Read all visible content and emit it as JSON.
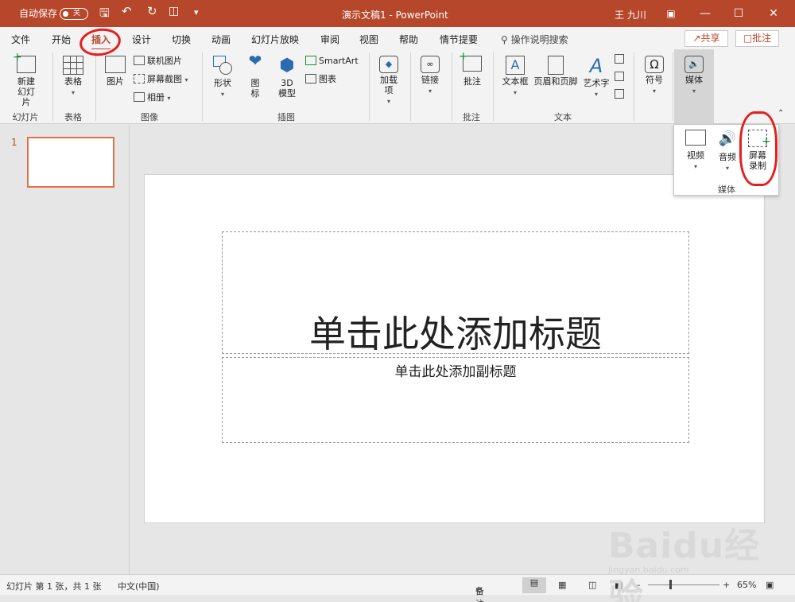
{
  "titlebar": {
    "autosave_label": "自动保存",
    "autosave_state": "关",
    "doc_title": "演示文稿1 - PowerPoint",
    "user": "王 九川"
  },
  "tabs": {
    "items": [
      "文件",
      "开始",
      "插入",
      "设计",
      "切换",
      "动画",
      "幻灯片放映",
      "审阅",
      "视图",
      "帮助",
      "情节提要"
    ],
    "active": "插入",
    "search": "操作说明搜索",
    "share": "共享",
    "comment": "批注"
  },
  "ribbon": {
    "slides_group": {
      "label": "幻灯片",
      "new_slide": "新建幻灯片"
    },
    "table_group": {
      "label": "表格",
      "table": "表格"
    },
    "image_group": {
      "label": "图像",
      "picture": "图片",
      "online": "联机图片",
      "screenshot": "屏幕截图",
      "album": "相册"
    },
    "illus_group": {
      "label": "插图",
      "shapes": "形状",
      "icons": "图标",
      "model3d": "3D 模型",
      "smartart": "SmartArt",
      "chart": "图表"
    },
    "addins": "加载项",
    "links": "链接",
    "comments_group": {
      "label": "批注",
      "comment": "批注"
    },
    "text_group": {
      "label": "文本",
      "textbox": "文本框",
      "header_footer": "页眉和页脚",
      "wordart": "艺术字"
    },
    "symbols": "符号",
    "media": "媒体"
  },
  "media_dropdown": {
    "video": "视频",
    "audio": "音频",
    "screen_rec": "屏幕录制",
    "label": "媒体"
  },
  "slide_panel": {
    "num": "1"
  },
  "slide": {
    "title_placeholder": "单击此处添加标题",
    "subtitle_placeholder": "单击此处添加副标题"
  },
  "status": {
    "slide_info": "幻灯片 第 1 张，共 1 张",
    "lang": "中文(中国)",
    "notes": "备注",
    "zoom": "65%"
  },
  "watermark": {
    "text": "Baidu经验",
    "sub": "jingyan.baidu.com"
  },
  "colors": {
    "accent": "#b7472a",
    "annotation": "#e51f1f"
  }
}
